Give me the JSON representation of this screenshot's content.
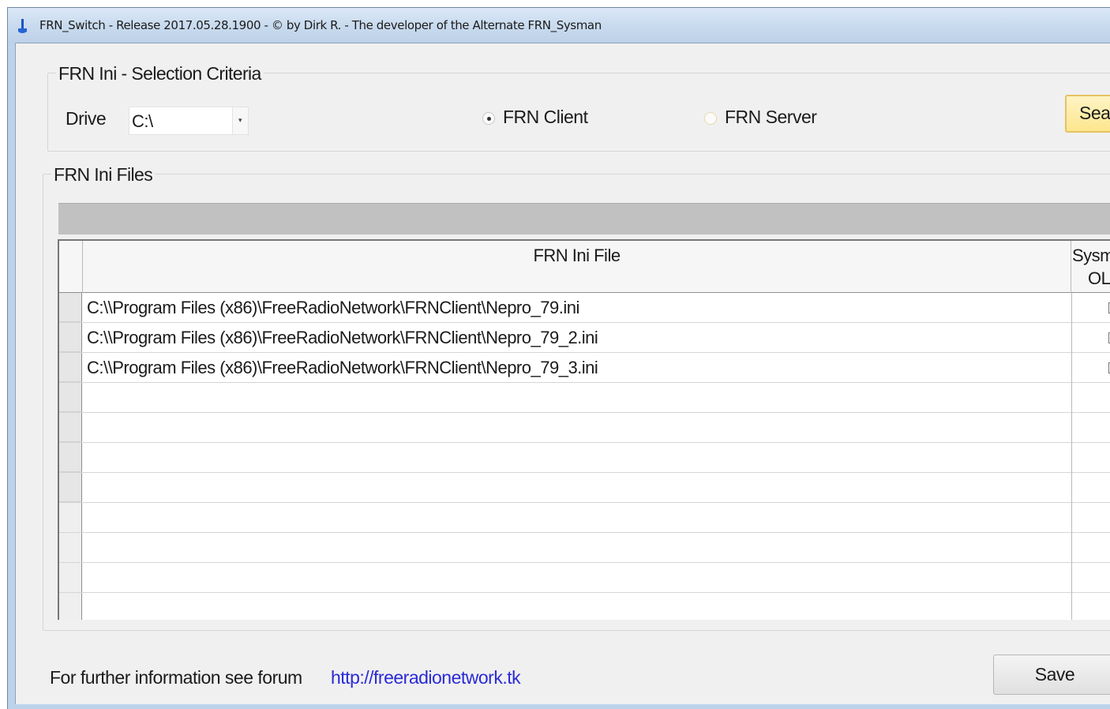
{
  "window": {
    "title": "FRN_Switch - Release 2017.05.28.1900 - © by Dirk R. - The developer of the Alternate FRN_Sysman"
  },
  "selection": {
    "legend": "FRN Ini - Selection Criteria",
    "drive_label": "Drive",
    "drive_value": "C:\\",
    "radio_client": {
      "label": "FRN Client",
      "checked": true
    },
    "radio_server": {
      "label": "FRN Server",
      "checked": false
    },
    "search_button_label": "Sear"
  },
  "files": {
    "legend": "FRN Ini Files",
    "columns": {
      "file": "FRN Ini File",
      "sysman_line1": "Sysm",
      "sysman_line2": "OL"
    },
    "rows": [
      {
        "file": "C:\\\\Program Files (x86)\\FreeRadioNetwork\\FRNClient\\Nepro_79.ini",
        "checked": true
      },
      {
        "file": "C:\\\\Program Files (x86)\\FreeRadioNetwork\\FRNClient\\Nepro_79_2.ini",
        "checked": true
      },
      {
        "file": "C:\\\\Program Files (x86)\\FreeRadioNetwork\\FRNClient\\Nepro_79_3.ini",
        "checked": false
      }
    ]
  },
  "footer": {
    "info_text": "For further information see forum",
    "link_text": "http://freeradionetwork.tk",
    "save_label": "Save"
  },
  "colors": {
    "link": "#2a2ad8",
    "search_button": "#fde68e",
    "title_bar": "#c9dbef"
  }
}
